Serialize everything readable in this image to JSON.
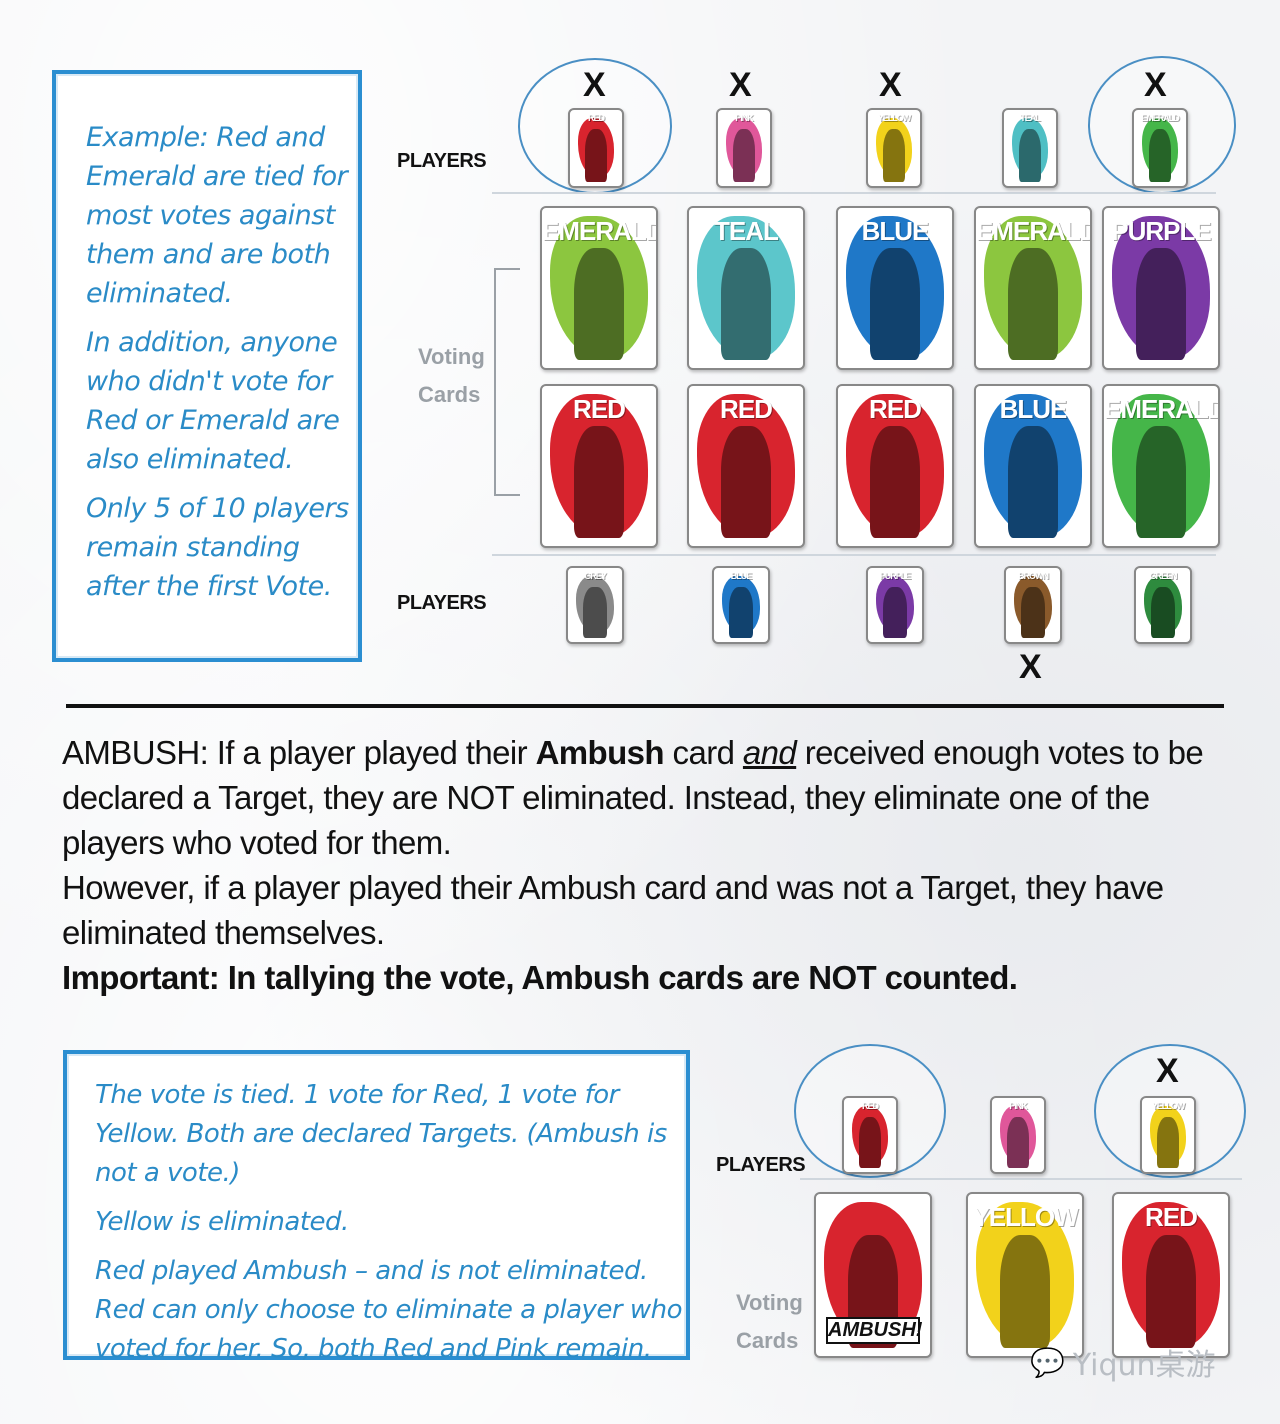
{
  "example1": {
    "paragraphs": [
      "Example: Red and Emerald are tied for most votes against them and are both eliminated.",
      "In addition, anyone who didn't vote for Red or Emerald are also eliminated.",
      "Only 5 of 10 players remain standing after the first Vote."
    ],
    "players_label_top": "PLAYERS",
    "players_label_bottom": "PLAYERS",
    "voting_label_1": "Voting",
    "voting_label_2": "Cards",
    "x_mark": "X",
    "top_players": [
      {
        "name": "RED",
        "color": "#d8242e",
        "x": true,
        "circled": true
      },
      {
        "name": "PINK",
        "color": "#e0579a",
        "x": true,
        "circled": false
      },
      {
        "name": "YELLOW",
        "color": "#f2d21b",
        "x": true,
        "circled": false
      },
      {
        "name": "TEAL",
        "color": "#4fbfc4",
        "x": false,
        "circled": false
      },
      {
        "name": "EMERALD",
        "color": "#45b649",
        "x": true,
        "circled": true
      }
    ],
    "vote_row1": [
      {
        "name": "EMERALD",
        "color": "#8cc63f"
      },
      {
        "name": "TEAL",
        "color": "#5cc6cb"
      },
      {
        "name": "BLUE",
        "color": "#1f78c8"
      },
      {
        "name": "EMERALD",
        "color": "#8cc63f"
      },
      {
        "name": "PURPLE",
        "color": "#7b3aa6"
      }
    ],
    "vote_row2": [
      {
        "name": "RED",
        "color": "#d8242e"
      },
      {
        "name": "RED",
        "color": "#d8242e"
      },
      {
        "name": "RED",
        "color": "#d8242e"
      },
      {
        "name": "BLUE",
        "color": "#1f78c8"
      },
      {
        "name": "EMERALD",
        "color": "#45b649"
      }
    ],
    "bottom_players": [
      {
        "name": "GREY",
        "color": "#8a8a8a",
        "x": false
      },
      {
        "name": "BLUE",
        "color": "#1f78c8",
        "x": false
      },
      {
        "name": "PURPLE",
        "color": "#7b3aa6",
        "x": false
      },
      {
        "name": "BROWN",
        "color": "#8a5a2b",
        "x": true
      },
      {
        "name": "GREEN",
        "color": "#2e8b3e",
        "x": false
      }
    ]
  },
  "rules": {
    "l1_a": "AMBUSH: If a player played their ",
    "l1_b": "Ambush",
    "l1_c": " card ",
    "l1_d": "and",
    "l1_e": " received enough votes to be",
    "l2": "declared a Target, they are NOT eliminated. Instead, they eliminate one of the",
    "l3": "players who voted for them.",
    "l4": "However, if a player played their Ambush card and was not a Target, they have",
    "l5": "eliminated themselves.",
    "l6": "Important: In tallying the vote, Ambush cards are NOT counted."
  },
  "example2": {
    "paragraphs": [
      "The vote is tied. 1 vote for Red, 1 vote for Yellow. Both are declared Targets. (Ambush is not a vote.)",
      "Yellow is eliminated.",
      "Red played Ambush – and is not eliminated. Red can only choose to eliminate a player who voted for her. So, both Red and Pink remain."
    ],
    "players_label": "PLAYERS",
    "voting_label_1": "Voting",
    "voting_label_2": "Cards",
    "x_mark": "X",
    "players": [
      {
        "name": "RED",
        "color": "#d8242e",
        "circled": true,
        "x": false
      },
      {
        "name": "PINK",
        "color": "#e0579a",
        "circled": false,
        "x": false
      },
      {
        "name": "YELLOW",
        "color": "#f2d21b",
        "circled": true,
        "x": true
      }
    ],
    "votes": [
      {
        "name": "AMBUSH!",
        "color": "#d8242e"
      },
      {
        "name": "YELLOW",
        "color": "#f2d21b"
      },
      {
        "name": "RED",
        "color": "#d8242e"
      }
    ]
  },
  "watermark": "Yiqun桌游"
}
